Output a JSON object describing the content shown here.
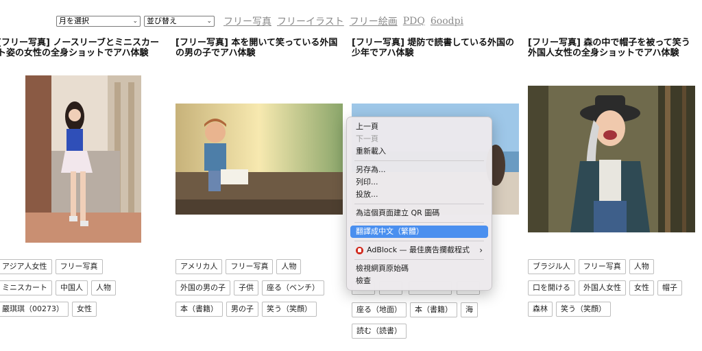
{
  "topnav": {
    "month_select": "月を選択",
    "sort_select": "並び替え",
    "links": [
      "フリー写真",
      "フリーイラスト",
      "フリー絵画",
      "PDQ",
      "6oodpi"
    ]
  },
  "cards": [
    {
      "title": "[フリー写真] ノースリーブとミニスカート姿の女性の全身ショットでアハ体験",
      "tags": [
        "アジア人女性",
        "フリー写真",
        "ミニスカート",
        "中国人",
        "人物",
        "嚴琪琪（00273）",
        "女性"
      ]
    },
    {
      "title": "[フリー写真] 本を開いて笑っている外国の男の子でアハ体験",
      "tags": [
        "アメリカ人",
        "フリー写真",
        "人物",
        "外国の男の子",
        "子供",
        "座る（ベンチ）",
        "本（書籍）",
        "男の子",
        "笑う（笑顔）"
      ]
    },
    {
      "title": "[フリー写真] 堤防で読書している外国の少年でアハ体験",
      "tags": [
        "座る（地面）",
        "本（書籍）",
        "海",
        "読む（読書）"
      ]
    },
    {
      "title": "[フリー写真] 森の中で帽子を被って笑う外国人女性の全身ショットでアハ体験",
      "tags": [
        "ブラジル人",
        "フリー写真",
        "人物",
        "口を開ける",
        "外国人女性",
        "女性",
        "帽子",
        "森林",
        "笑う（笑顔）"
      ]
    }
  ],
  "context_menu": {
    "items": [
      {
        "label": "上一頁"
      },
      {
        "label": "下一頁"
      },
      {
        "label": "重新載入"
      },
      {
        "label": "另存為..."
      },
      {
        "label": "列印..."
      },
      {
        "label": "投放..."
      },
      {
        "label": "為這個頁面建立 QR 圖碼"
      },
      {
        "label": "翻譯成中文（繁體）"
      },
      {
        "label": "AdBlock — 最佳廣告攔截程式"
      },
      {
        "label": "檢視網頁原始碼"
      },
      {
        "label": "檢查"
      }
    ],
    "icons": {
      "adblock": "adblock-icon",
      "submenu": "chevron-right-icon"
    }
  },
  "colors": {
    "menu_highlight": "#4a8fef",
    "link_gray": "#8a8a8a",
    "adblock_red": "#d1291d"
  }
}
